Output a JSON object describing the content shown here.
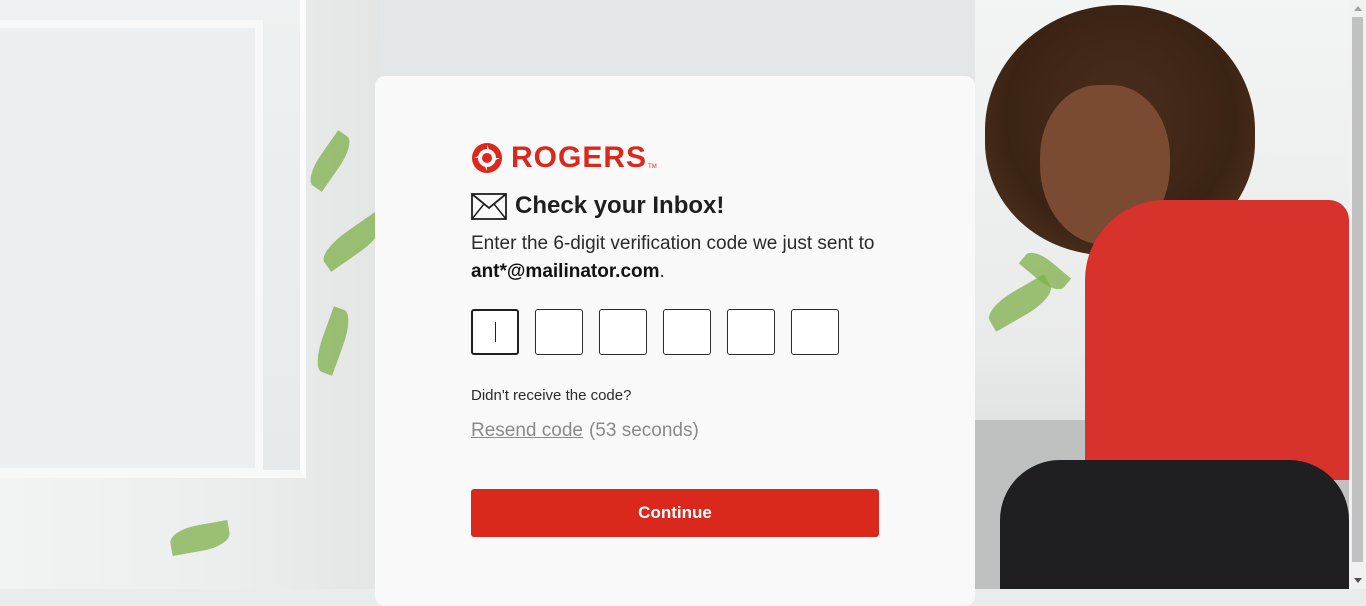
{
  "brand": {
    "name": "ROGERS",
    "trademark": "TM",
    "accent_color": "#da291c"
  },
  "verify": {
    "icon": "envelope-icon",
    "heading": "Check your Inbox!",
    "description_prefix": "Enter the 6-digit verification code we just sent to ",
    "email": "ant*@mailinator.com",
    "description_suffix": ".",
    "code_digits": [
      "",
      "",
      "",
      "",
      "",
      ""
    ],
    "didnt_receive": "Didn't receive the code?",
    "resend_label": "Resend code",
    "resend_timer": "(53 seconds)",
    "continue_label": "Continue"
  }
}
